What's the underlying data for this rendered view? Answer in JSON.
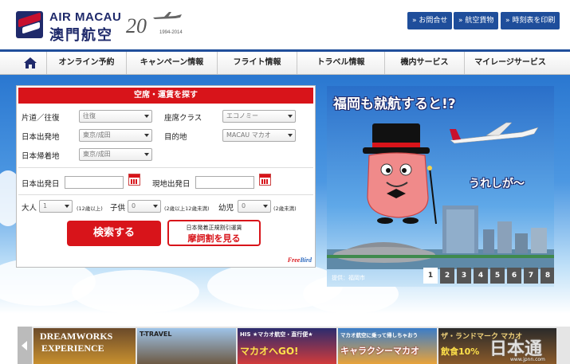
{
  "header": {
    "brand_en": "AIR MACAU",
    "brand_jp": "澳門航空",
    "anniversary_number": "20",
    "anniversary_years": "1994-2014",
    "buttons": [
      {
        "label": "» お問合せ"
      },
      {
        "label": "» 航空貨物"
      },
      {
        "label": "» 時刻表を印刷"
      }
    ]
  },
  "nav": {
    "items": [
      {
        "label": "オンライン予約"
      },
      {
        "label": "キャンペーン情報"
      },
      {
        "label": "フライト情報"
      },
      {
        "label": "トラベル情報"
      },
      {
        "label": "機内サービス"
      },
      {
        "label": "マイレージサービス"
      }
    ]
  },
  "search": {
    "title": "空席・運賃を探す",
    "trip_type_label": "片道／往復",
    "trip_type_value": "往復",
    "cabin_label": "座席クラス",
    "cabin_value": "エコノミー",
    "origin_label": "日本出発地",
    "origin_value": "東京/成田",
    "destination_label": "目的地",
    "destination_value": "MACAU マカオ",
    "return_label": "日本帰着地",
    "return_value": "東京/成田",
    "depart_date_label": "日本出発日",
    "local_date_label": "現地出発日",
    "adult_label": "大人",
    "adult_value": "1",
    "adult_note": "(12歳以上)",
    "child_label": "子供",
    "child_value": "0",
    "child_note": "(2歳以上12歳未満)",
    "infant_label": "幼児",
    "infant_value": "0",
    "infant_note": "(2歳未満)",
    "search_button": "検索する",
    "fare_button_line1": "日本発着正規割引運賃",
    "fare_button_line2": "摩詞割を見る",
    "freebird_free": "Free",
    "freebird_bird": "Bird"
  },
  "banner": {
    "headline": "福岡も就航すると!?",
    "sub": "うれしが〜",
    "credit": "提供：福岡市",
    "pages": [
      "1",
      "2",
      "3",
      "4",
      "5",
      "6",
      "7",
      "8"
    ],
    "active_page": "1"
  },
  "thumbs": [
    {
      "title": "DREAMWORKS",
      "sub": "EXPERIENCE"
    },
    {
      "title": "T-TRAVEL",
      "sub": ""
    },
    {
      "title": "HIS ★マカオ航空・直行便★",
      "sub": "マカオへGO!"
    },
    {
      "title": "マカオ航空に乗って帰しちゃおう",
      "sub": "キャラクシーマカオ"
    },
    {
      "title": "ザ・ランドマーク マカオ",
      "sub": "飲食10%"
    }
  ],
  "watermark": {
    "text": "日本通",
    "url": "www.jpnn.com"
  },
  "colors": {
    "brand_navy": "#1f2a6b",
    "accent_red": "#d8141a",
    "button_blue": "#1f4e9b"
  }
}
